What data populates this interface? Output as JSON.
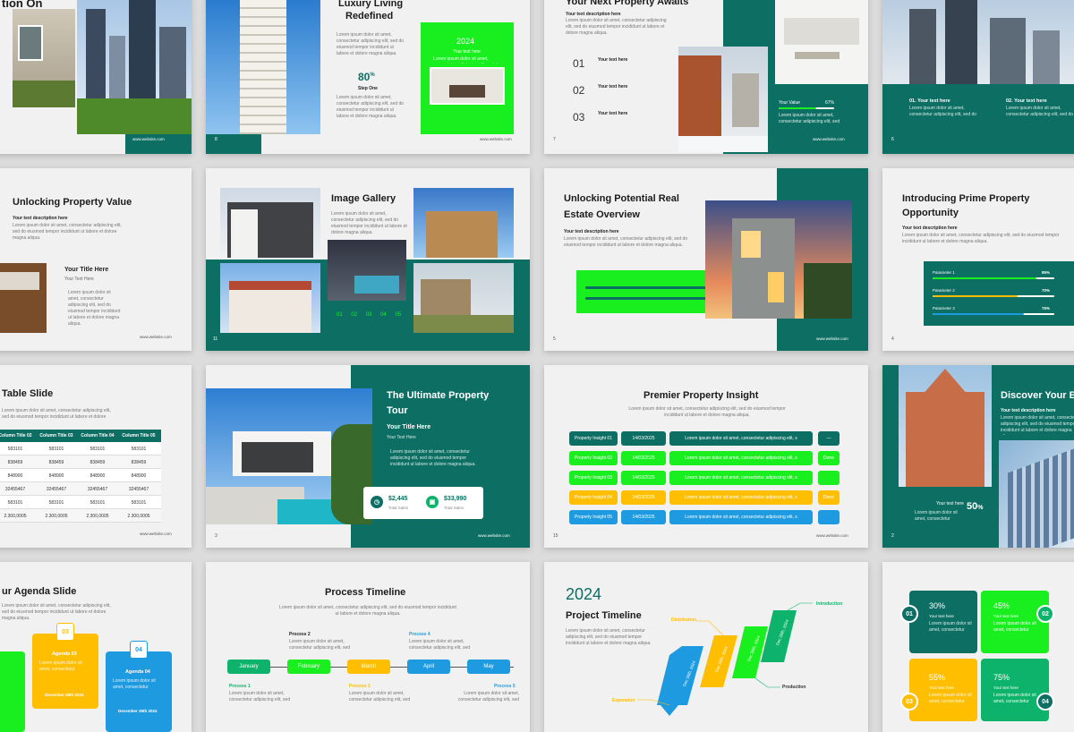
{
  "colors": {
    "teal": "#0d6e63",
    "lime": "#19ef1f",
    "yellow": "#ffbf00",
    "blue": "#1e9be0"
  },
  "website": "www.website.com",
  "lorem": "Lorem ipsum dolor sit amet, consectetur adipiscing elit, sed do eiusmod tempor incididunt ut labore et dolore magna aliqua.",
  "s_r1c1": {
    "title": "tion On",
    "page": ""
  },
  "s_r1c2": {
    "title1": "Luxury Living",
    "title2": "Redefined",
    "year": "2024",
    "subtitle": "Your text here",
    "stat": "80",
    "stat_unit": "%",
    "step": "Step One",
    "page": "8"
  },
  "s_r1c3": {
    "title": "Your Next Property Awaits",
    "desc": "Your text description here",
    "items": [
      {
        "n": "01",
        "label": "Your text here"
      },
      {
        "n": "02",
        "label": "Your text here"
      },
      {
        "n": "03",
        "label": "Your text here"
      }
    ],
    "value_label": "Your Value",
    "value_pct": "67%",
    "value_fraction": 0.67,
    "page": "7"
  },
  "s_r1c4": {
    "item1": "01. Your text here",
    "item2": "02. Your text here",
    "page": "6"
  },
  "s_r2c1": {
    "title": "Unlocking Property Value",
    "desc": "Your text description here",
    "sub_title": "Your Title Here",
    "sub_text": "Your Text Here"
  },
  "s_r2c2": {
    "title": "Image Gallery",
    "nums": [
      "01",
      "02",
      "03",
      "04",
      "05"
    ],
    "page": "11"
  },
  "s_r2c3": {
    "title1": "Unlocking Potential Real",
    "title2": "Estate Overview",
    "desc": "Your text description here",
    "page": "5"
  },
  "s_r2c4": {
    "title1": "Introducing Prime Property",
    "title2": "Opportunity",
    "desc": "Your text description here",
    "params": [
      {
        "label": "Parameter 1",
        "pct": "85%",
        "v": 0.85
      },
      {
        "label": "Parameter 2",
        "pct": "70%",
        "v": 0.7
      },
      {
        "label": "Parameter 3",
        "pct": "75%",
        "v": 0.75
      }
    ],
    "page": "4"
  },
  "s_r3c1": {
    "title": "Table Slide",
    "headers": [
      "Column Title 02",
      "Column Title 03",
      "Column Title 04",
      "Column Title 05"
    ],
    "rows": [
      [
        "583101",
        "583101",
        "583101",
        "583101"
      ],
      [
        "838459",
        "838459",
        "838459",
        "838459"
      ],
      [
        "848900",
        "848900",
        "848900",
        "848900"
      ],
      [
        "32455467",
        "32455467",
        "32455467",
        "32455467"
      ],
      [
        "583101",
        "583101",
        "583101",
        "583101"
      ],
      [
        "2.300,0005",
        "2.300,0005",
        "2.300,0005",
        "2.300,0005"
      ]
    ]
  },
  "s_r3c2": {
    "title1": "The Ultimate Property",
    "title2": "Tour",
    "sub_title": "Your Title Here",
    "sub_text": "Your Text Here",
    "stat1": "$2,445",
    "stat1_label": "Total Sales",
    "stat2": "$33,990",
    "stat2_label": "Total Sales",
    "page": "3"
  },
  "s_r3c3": {
    "title": "Premier Property Insight",
    "rows": [
      {
        "label": "Property Insight 01",
        "date": "14/03/2025",
        "status": "—"
      },
      {
        "label": "Property Insight 02",
        "date": "14/03/2025",
        "status": "Done"
      },
      {
        "label": "Property Insight 03",
        "date": "14/03/2025",
        "status": ""
      },
      {
        "label": "Property Insight 04",
        "date": "14/03/2025",
        "status": "Done"
      },
      {
        "label": "Property Insight 05",
        "date": "14/03/2025",
        "status": ""
      }
    ],
    "page": "15"
  },
  "s_r3c4": {
    "title": "Discover Your E",
    "desc": "Your text description here",
    "label": "Your text here",
    "stat": "50",
    "stat_unit": "%",
    "page": "2"
  },
  "s_r4c1": {
    "title": "ur Agenda Slide",
    "card3": {
      "n": "03",
      "title": "Agenda 03",
      "date": "December 28th 2024"
    },
    "card4": {
      "n": "04",
      "title": "Agenda 04",
      "date": "December 28th 2024"
    }
  },
  "s_r4c2": {
    "title": "Process Timeline",
    "months": [
      "January",
      "February",
      "March",
      "April",
      "May"
    ],
    "procs_top": [
      "Process 2",
      "Process 4"
    ],
    "procs_bottom": [
      "Process 1",
      "Process 3",
      "Process 5"
    ]
  },
  "s_r4c3": {
    "year": "2024",
    "title": "Project Timeline",
    "labels": [
      "Introduction",
      "Distribution",
      "Production",
      "Expansion"
    ],
    "dates": [
      "Dec 28th, 2024",
      "Dec 28th, 2024",
      "Dec 28th, 2024",
      "Dec 28th, 2024"
    ]
  },
  "s_r4c4": {
    "items": [
      {
        "n": "01",
        "pct": "30%"
      },
      {
        "n": "02",
        "pct": "45%"
      },
      {
        "n": "03",
        "pct": "55%"
      },
      {
        "n": "04",
        "pct": "75%"
      }
    ],
    "label": "Your text here"
  }
}
